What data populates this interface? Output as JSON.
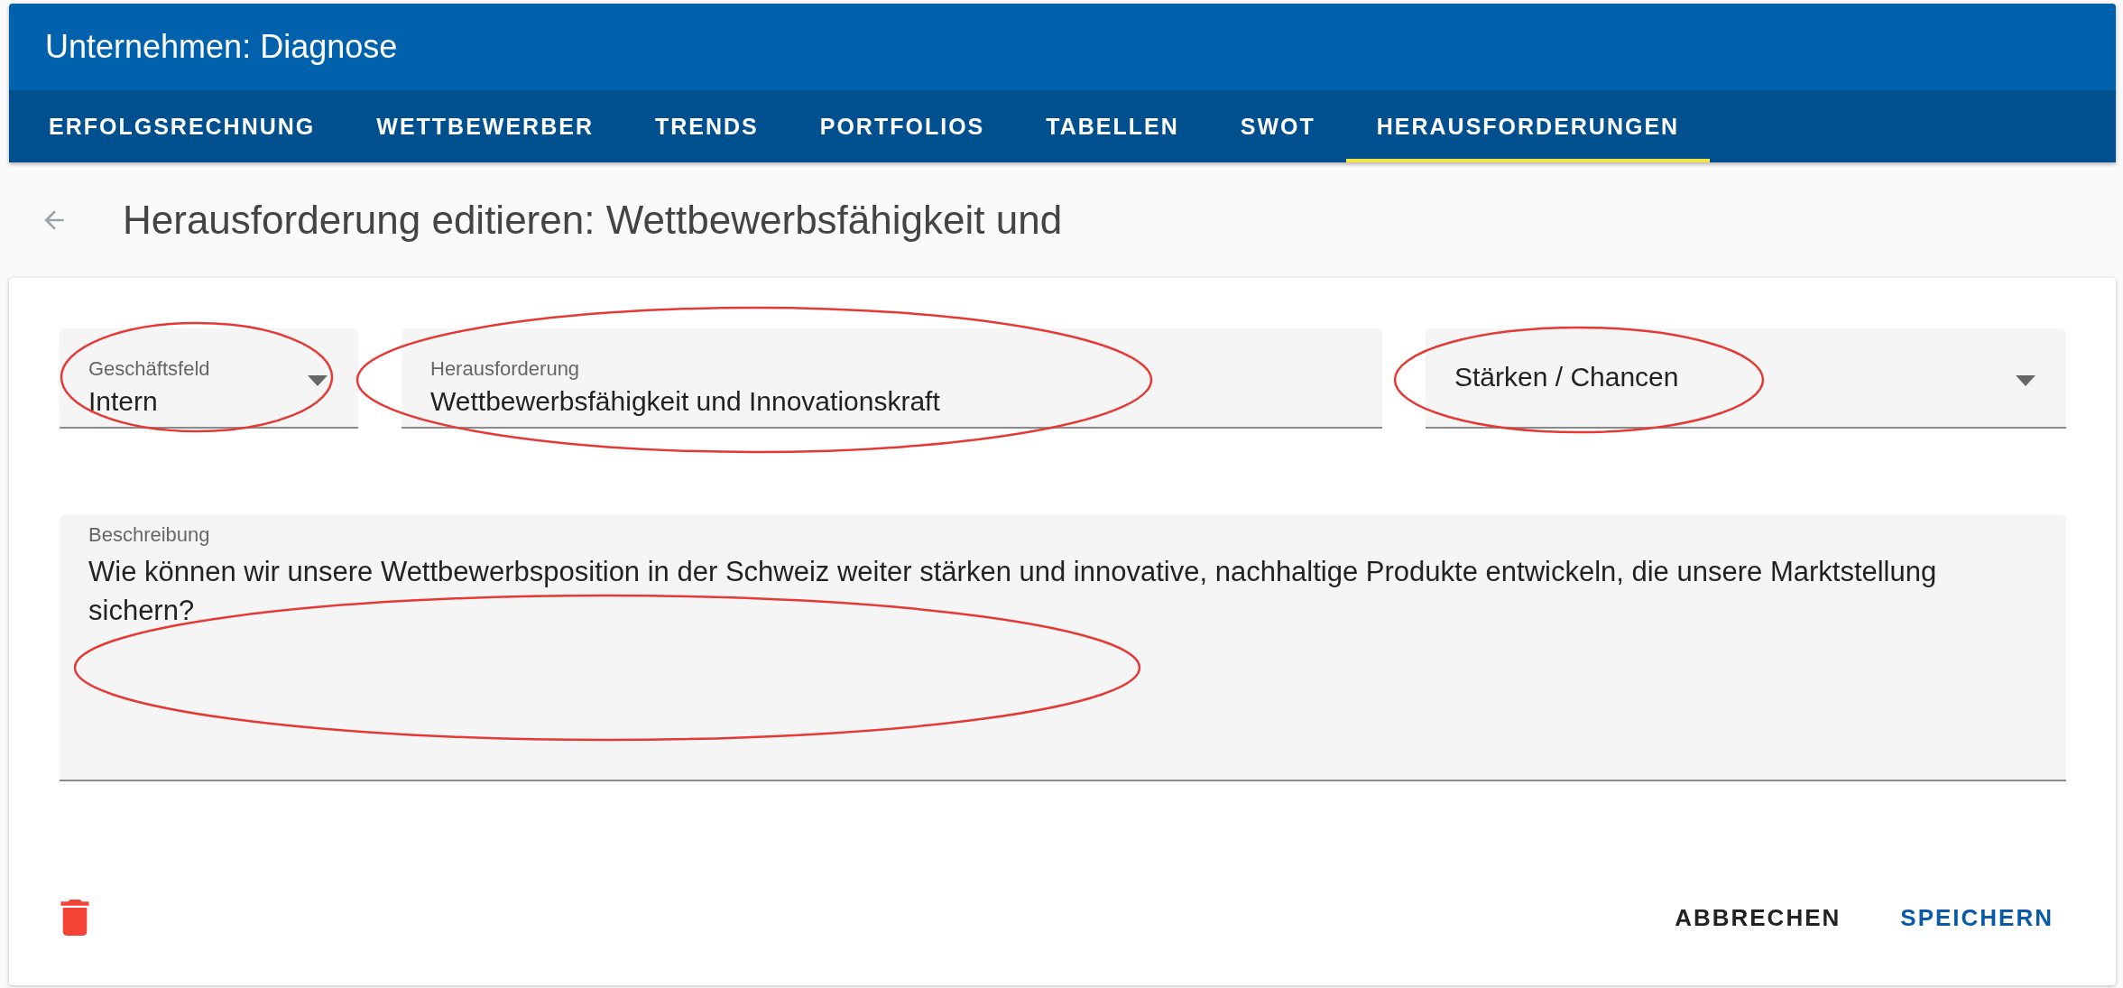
{
  "app_bar": {
    "title": "Unternehmen: Diagnose"
  },
  "tabs": [
    {
      "label": "ERFOLGSRECHNUNG",
      "selected": false
    },
    {
      "label": "WETTBEWERBER",
      "selected": false
    },
    {
      "label": "TRENDS",
      "selected": false
    },
    {
      "label": "PORTFOLIOS",
      "selected": false
    },
    {
      "label": "TABELLEN",
      "selected": false
    },
    {
      "label": "SWOT",
      "selected": false
    },
    {
      "label": "HERAUSFORDERUNGEN",
      "selected": true
    }
  ],
  "page_title": "Herausforderung editieren: Wettbewerbsfähigkeit und",
  "form": {
    "fields": [
      {
        "kind": "select",
        "label": "Geschäftsfeld",
        "value": "Intern"
      },
      {
        "kind": "text",
        "label": "Herausforderung",
        "value": "Wettbewerbsfähigkeit und Innovationskraft"
      },
      {
        "kind": "select",
        "value": "Stärken / Chancen"
      }
    ],
    "description": {
      "label": "Beschreibung",
      "value": "Wie können wir unsere Wettbewerbsposition in der Schweiz weiter stärken und innovative, nachhaltige Produkte entwickeln, die unsere Marktstellung sichern?"
    }
  },
  "actions": [
    "ABBRECHEN",
    "SPEICHERN"
  ]
}
